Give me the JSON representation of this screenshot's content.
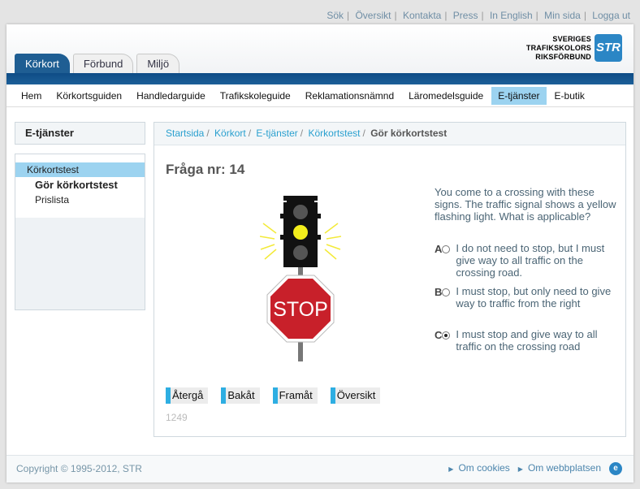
{
  "top_links": [
    "Sök",
    "Översikt",
    "Kontakta",
    "Press",
    "In English",
    "Min sida",
    "Logga ut"
  ],
  "tabs": [
    "Körkort",
    "Förbund",
    "Miljö"
  ],
  "logo": {
    "line1": "SVERIGES",
    "line2": "TRAFIKSKOLORS",
    "line3": "RIKSFÖRBUND",
    "mark": "STR"
  },
  "main_nav": [
    "Hem",
    "Körkortsguiden",
    "Handledarguide",
    "Trafikskoleguide",
    "Reklamationsnämnd",
    "Läromedelsguide",
    "E-tjänster",
    "E-butik"
  ],
  "sidebar": {
    "title": "E-tjänster",
    "items": [
      "Körkortstest",
      "Gör körkortstest",
      "Prislista"
    ]
  },
  "breadcrumb": [
    "Startsida",
    "Körkort",
    "E-tjänster",
    "Körkortstest",
    "Gör körkortstest"
  ],
  "question": {
    "title": "Fråga nr: 14",
    "text": "You come to a crossing with these signs. The traffic signal shows a yellow flashing light. What is applicable?",
    "sign_text": "STOP",
    "answers": [
      {
        "letter": "A",
        "text": "I do not need to stop, but I must give way to all traffic on the crossing road."
      },
      {
        "letter": "B",
        "text": "I must stop, but only need to give way to traffic from the right"
      },
      {
        "letter": "C",
        "text": "I must stop and give way to all traffic on the crossing road"
      }
    ],
    "selected": "C",
    "id": "1249"
  },
  "buttons": [
    "Återgå",
    "Bakåt",
    "Framåt",
    "Översikt"
  ],
  "footer": {
    "copyright": "Copyright © 1995-2012, STR",
    "links": [
      "Om cookies",
      "Om webbplatsen"
    ]
  },
  "colors": {
    "brand_blue": "#1f5e93",
    "accent_cyan": "#2eaee2",
    "nav_highlight": "#9cd3f0"
  }
}
